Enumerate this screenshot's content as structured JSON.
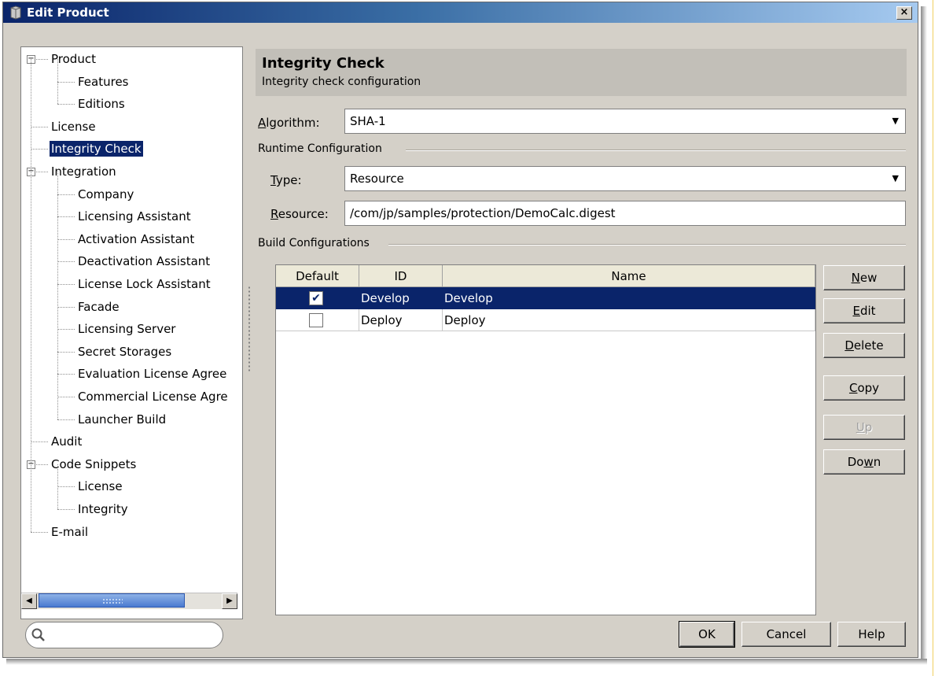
{
  "window": {
    "title": "Edit Product",
    "close_label": "×"
  },
  "tree": {
    "items": [
      {
        "label": "Product",
        "level": 0,
        "expanded": true
      },
      {
        "label": "Features",
        "level": 1
      },
      {
        "label": "Editions",
        "level": 1
      },
      {
        "label": "License",
        "level": 0
      },
      {
        "label": "Integrity Check",
        "level": 0,
        "selected": true
      },
      {
        "label": "Integration",
        "level": 0,
        "expanded": true
      },
      {
        "label": "Company",
        "level": 1
      },
      {
        "label": "Licensing Assistant",
        "level": 1
      },
      {
        "label": "Activation Assistant",
        "level": 1
      },
      {
        "label": "Deactivation Assistant",
        "level": 1
      },
      {
        "label": "License Lock Assistant",
        "level": 1
      },
      {
        "label": "Facade",
        "level": 1
      },
      {
        "label": "Licensing Server",
        "level": 1
      },
      {
        "label": "Secret Storages",
        "level": 1
      },
      {
        "label": "Evaluation License Agree",
        "level": 1
      },
      {
        "label": "Commercial License Agre",
        "level": 1
      },
      {
        "label": "Launcher Build",
        "level": 1
      },
      {
        "label": "Audit",
        "level": 0
      },
      {
        "label": "Code Snippets",
        "level": 0,
        "expanded": true
      },
      {
        "label": "License",
        "level": 1
      },
      {
        "label": "Integrity",
        "level": 1
      },
      {
        "label": "E-mail",
        "level": 0
      }
    ]
  },
  "search": {
    "placeholder": "",
    "value": ""
  },
  "header": {
    "title": "Integrity Check",
    "subtitle": "Integrity check configuration"
  },
  "algorithm": {
    "label_accel": "A",
    "label_rest": "lgorithm:",
    "value": "SHA-1"
  },
  "runtime": {
    "group_label": "Runtime Configuration",
    "type_label_accel": "T",
    "type_label_rest": "ype:",
    "type_value": "Resource",
    "resource_label_accel": "R",
    "resource_label_rest": "esource:",
    "resource_value": "/com/jp/samples/protection/DemoCalc.digest"
  },
  "build": {
    "group_label": "Build Configurations",
    "columns": [
      "Default",
      "ID",
      "Name"
    ],
    "rows": [
      {
        "default": true,
        "id": "Develop",
        "name": "Develop",
        "selected": true
      },
      {
        "default": false,
        "id": "Deploy",
        "name": "Deploy",
        "selected": false
      }
    ]
  },
  "side_buttons": [
    {
      "pre": "",
      "accel": "N",
      "post": "ew",
      "enabled": true
    },
    {
      "pre": "",
      "accel": "E",
      "post": "dit",
      "enabled": true
    },
    {
      "pre": "",
      "accel": "D",
      "post": "elete",
      "enabled": true
    },
    {
      "pre": "",
      "accel": "C",
      "post": "opy",
      "enabled": true
    },
    {
      "pre": "",
      "accel": "U",
      "post": "p",
      "enabled": false
    },
    {
      "pre": "Do",
      "accel": "w",
      "post": "n",
      "enabled": true
    }
  ],
  "footer": {
    "ok": "OK",
    "cancel": "Cancel",
    "help": "Help"
  },
  "icons": {
    "window": "product-icon",
    "search": "search-icon",
    "close": "close-icon"
  },
  "colors": {
    "selection": "#0a246a",
    "dialog_bg": "#d4d0c8",
    "header_bg": "#c2bfb8"
  }
}
